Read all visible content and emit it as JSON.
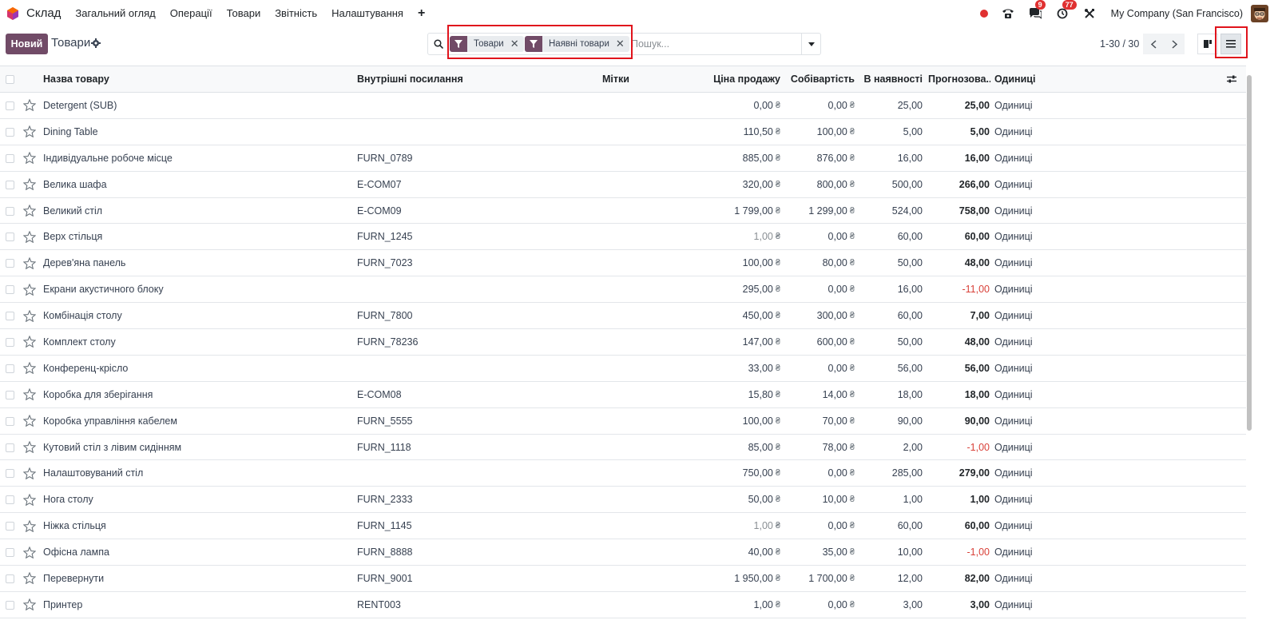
{
  "navbar": {
    "app_name": "Склад",
    "menu": [
      "Загальний огляд",
      "Операції",
      "Товари",
      "Звітність",
      "Налаштування"
    ],
    "plus": "+",
    "messages_badge": "9",
    "activities_badge": "77",
    "company": "My Company (San Francisco)"
  },
  "control": {
    "new_button": "Новий",
    "title": "Товари",
    "facets": [
      "Товари",
      "Наявні товари"
    ],
    "search_placeholder": "Пошук...",
    "pager": "1-30 / 30"
  },
  "columns": {
    "name": "Назва товару",
    "ref": "Внутрішні посилання",
    "tags": "Мітки",
    "price": "Ціна продажу",
    "cost": "Собівартість",
    "onhand": "В наявності",
    "forecast": "Прогнозова...",
    "uom": "Одиниці"
  },
  "currency_symbol": "₴",
  "rows": [
    {
      "name": "Detergent (SUB)",
      "ref": "",
      "price": "0,00",
      "cost": "0,00",
      "onhand": "25,00",
      "forecast": "25,00",
      "uom": "Одиниці"
    },
    {
      "name": "Dining Table",
      "ref": "",
      "price": "110,50",
      "cost": "100,00",
      "onhand": "5,00",
      "forecast": "5,00",
      "uom": "Одиниці"
    },
    {
      "name": "Індивідуальне робоче місце",
      "ref": "FURN_0789",
      "price": "885,00",
      "cost": "876,00",
      "onhand": "16,00",
      "forecast": "16,00",
      "uom": "Одиниці"
    },
    {
      "name": "Велика шафа",
      "ref": "E-COM07",
      "price": "320,00",
      "cost": "800,00",
      "onhand": "500,00",
      "forecast": "266,00",
      "uom": "Одиниці"
    },
    {
      "name": "Великий стіл",
      "ref": "E-COM09",
      "price": "1 799,00",
      "cost": "1 299,00",
      "onhand": "524,00",
      "forecast": "758,00",
      "uom": "Одиниці"
    },
    {
      "name": "Верх стільця",
      "ref": "FURN_1245",
      "price": "1,00",
      "cost": "0,00",
      "onhand": "60,00",
      "forecast": "60,00",
      "uom": "Одиниці"
    },
    {
      "name": "Дерев'яна панель",
      "ref": "FURN_7023",
      "price": "100,00",
      "cost": "80,00",
      "onhand": "50,00",
      "forecast": "48,00",
      "uom": "Одиниці"
    },
    {
      "name": "Екрани акустичного блоку",
      "ref": "",
      "price": "295,00",
      "cost": "0,00",
      "onhand": "16,00",
      "forecast": "-11,00",
      "uom": "Одиниці"
    },
    {
      "name": "Комбінація столу",
      "ref": "FURN_7800",
      "price": "450,00",
      "cost": "300,00",
      "onhand": "60,00",
      "forecast": "7,00",
      "uom": "Одиниці"
    },
    {
      "name": "Комплект столу",
      "ref": "FURN_78236",
      "price": "147,00",
      "cost": "600,00",
      "onhand": "50,00",
      "forecast": "48,00",
      "uom": "Одиниці"
    },
    {
      "name": "Конференц-крісло",
      "ref": "",
      "price": "33,00",
      "cost": "0,00",
      "onhand": "56,00",
      "forecast": "56,00",
      "uom": "Одиниці"
    },
    {
      "name": "Коробка для зберігання",
      "ref": "E-COM08",
      "price": "15,80",
      "cost": "14,00",
      "onhand": "18,00",
      "forecast": "18,00",
      "uom": "Одиниці"
    },
    {
      "name": "Коробка управління кабелем",
      "ref": "FURN_5555",
      "price": "100,00",
      "cost": "70,00",
      "onhand": "90,00",
      "forecast": "90,00",
      "uom": "Одиниці"
    },
    {
      "name": "Кутовий стіл з лівим сидінням",
      "ref": "FURN_1118",
      "price": "85,00",
      "cost": "78,00",
      "onhand": "2,00",
      "forecast": "-1,00",
      "uom": "Одиниці"
    },
    {
      "name": "Налаштовуваний стіл",
      "ref": "",
      "price": "750,00",
      "cost": "0,00",
      "onhand": "285,00",
      "forecast": "279,00",
      "uom": "Одиниці"
    },
    {
      "name": "Нога столу",
      "ref": "FURN_2333",
      "price": "50,00",
      "cost": "10,00",
      "onhand": "1,00",
      "forecast": "1,00",
      "uom": "Одиниці"
    },
    {
      "name": "Ніжка стільця",
      "ref": "FURN_1145",
      "price": "1,00",
      "cost": "0,00",
      "onhand": "60,00",
      "forecast": "60,00",
      "uom": "Одиниці"
    },
    {
      "name": "Офісна лампа",
      "ref": "FURN_8888",
      "price": "40,00",
      "cost": "35,00",
      "onhand": "10,00",
      "forecast": "-1,00",
      "uom": "Одиниці"
    },
    {
      "name": "Перевернути",
      "ref": "FURN_9001",
      "price": "1 950,00",
      "cost": "1 700,00",
      "onhand": "12,00",
      "forecast": "82,00",
      "uom": "Одиниці"
    },
    {
      "name": "Принтер",
      "ref": "RENT003",
      "price": "1,00",
      "cost": "0,00",
      "onhand": "3,00",
      "forecast": "3,00",
      "uom": "Одиниці"
    }
  ],
  "colors": {
    "brand": "#714b67",
    "badge": "#e03131",
    "negative": "#d9423a",
    "highlight": "#e0131c"
  }
}
